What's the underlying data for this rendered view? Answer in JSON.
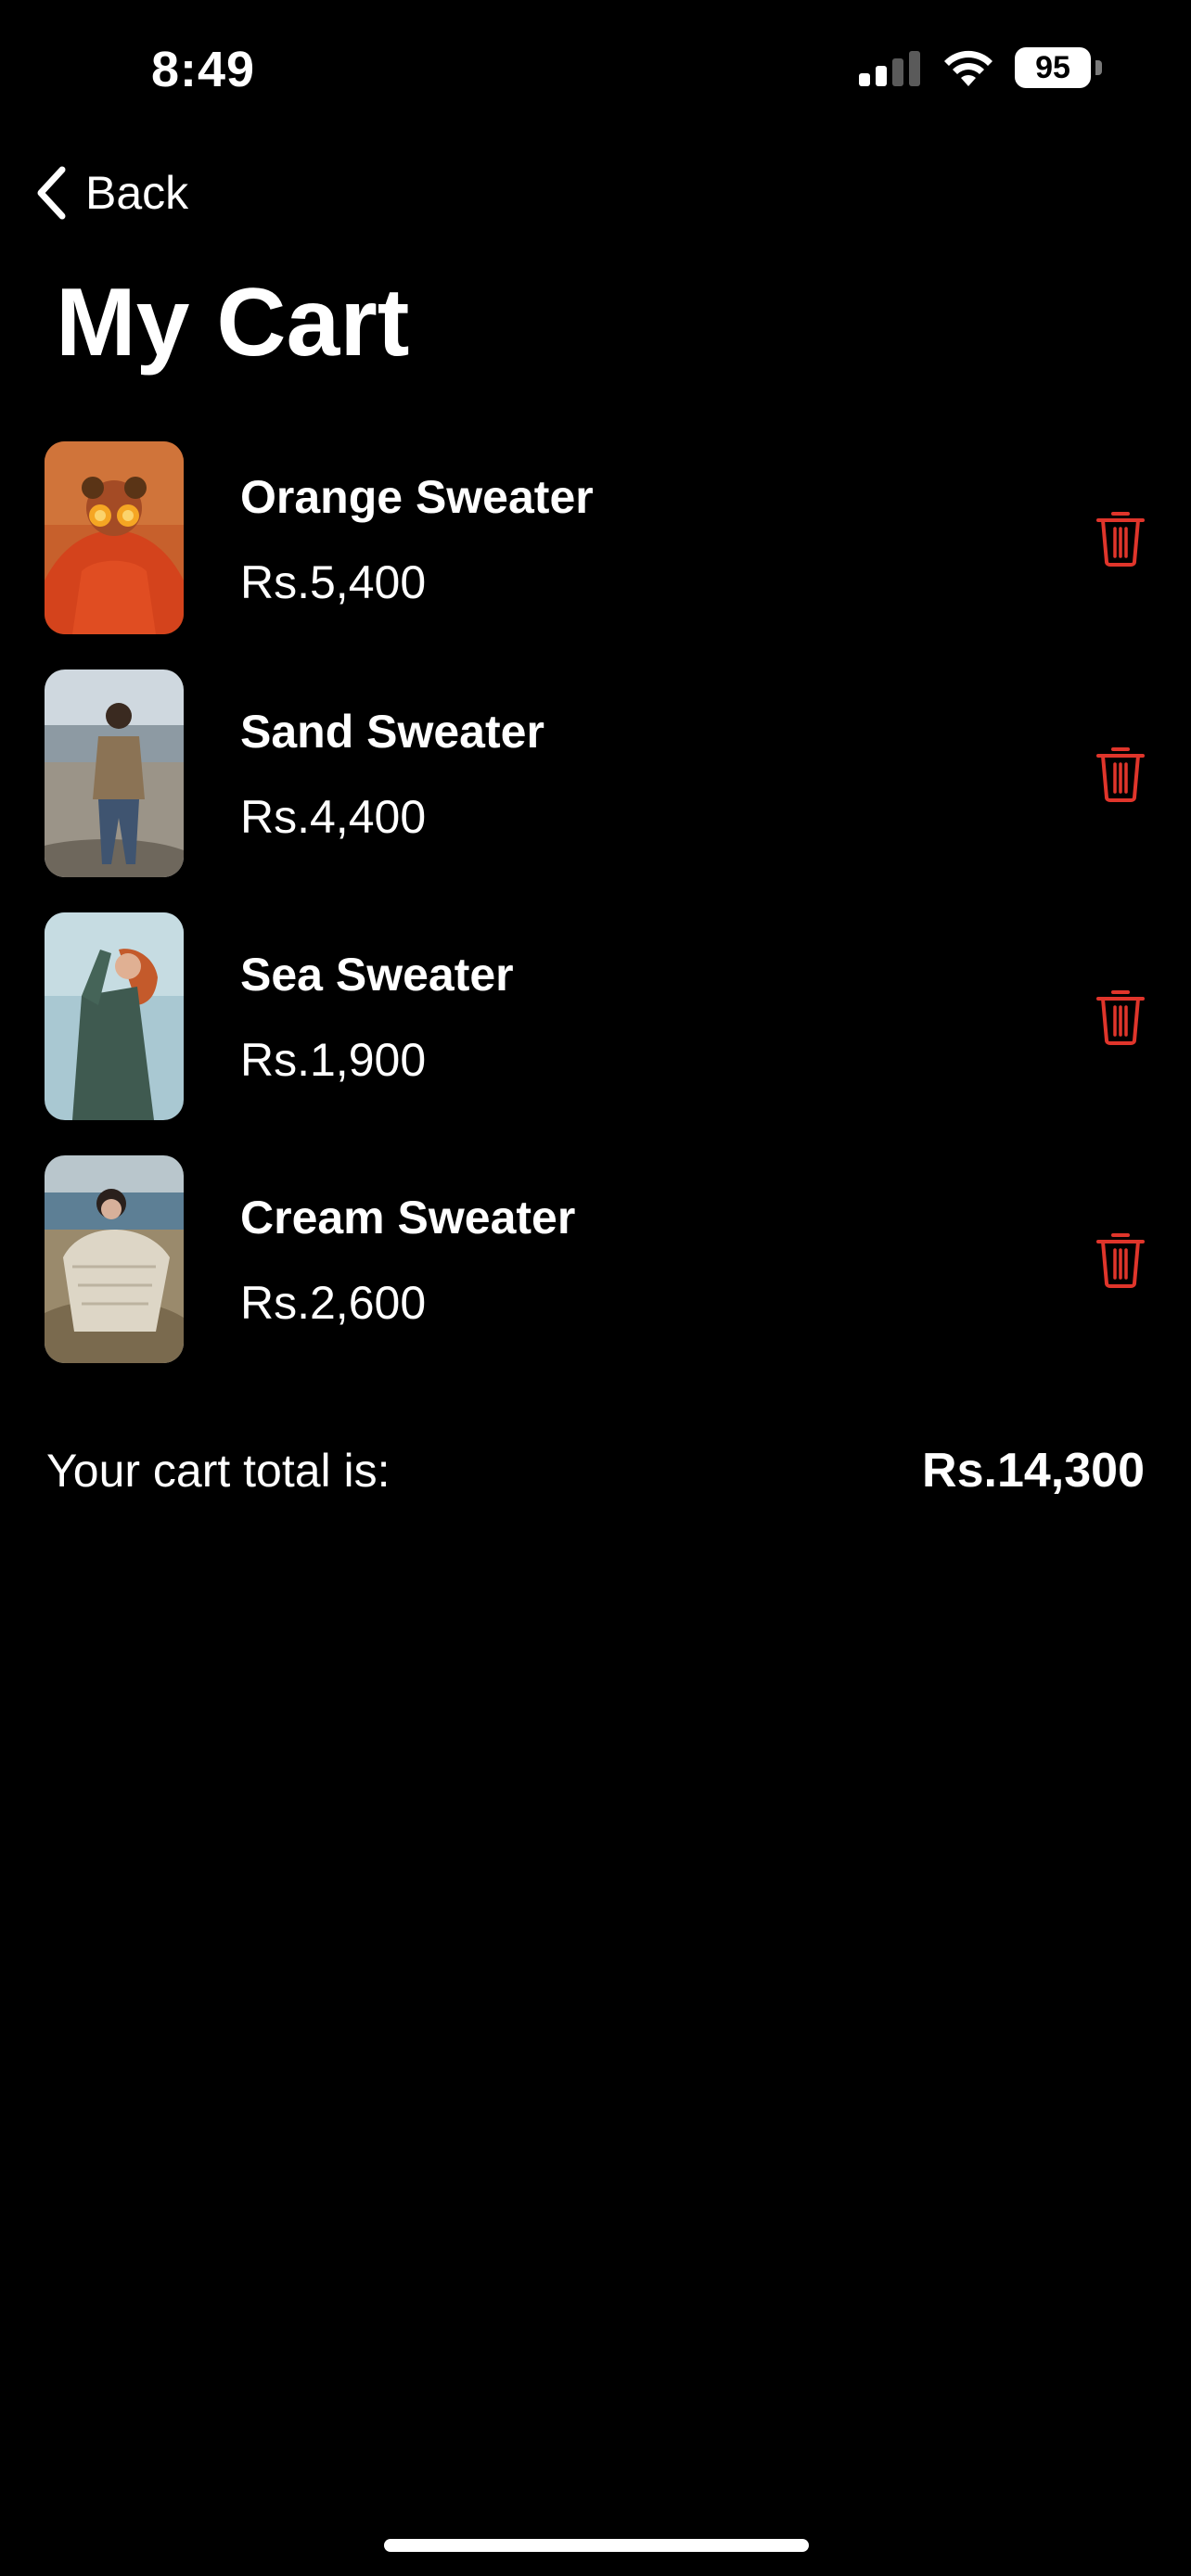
{
  "status_bar": {
    "time": "8:49",
    "battery_level": "95",
    "icons": [
      "signal-icon",
      "wifi-icon",
      "battery-icon"
    ]
  },
  "nav": {
    "back_label": "Back",
    "back_icon": "chevron-left-icon"
  },
  "page": {
    "title": "My Cart"
  },
  "cart": {
    "items": [
      {
        "name": "Orange Sweater",
        "price": "Rs.5,400",
        "image": "orange-sweater-photo",
        "delete_icon": "trash-icon"
      },
      {
        "name": "Sand Sweater",
        "price": "Rs.4,400",
        "image": "sand-sweater-photo",
        "delete_icon": "trash-icon"
      },
      {
        "name": "Sea Sweater",
        "price": "Rs.1,900",
        "image": "sea-sweater-photo",
        "delete_icon": "trash-icon"
      },
      {
        "name": "Cream Sweater",
        "price": "Rs.2,600",
        "image": "cream-sweater-photo",
        "delete_icon": "trash-icon"
      }
    ],
    "total_label": "Your cart total is:",
    "total_value": "Rs.14,300"
  },
  "colors": {
    "background": "#000000",
    "text": "#ffffff",
    "delete_accent": "#e0352b"
  }
}
